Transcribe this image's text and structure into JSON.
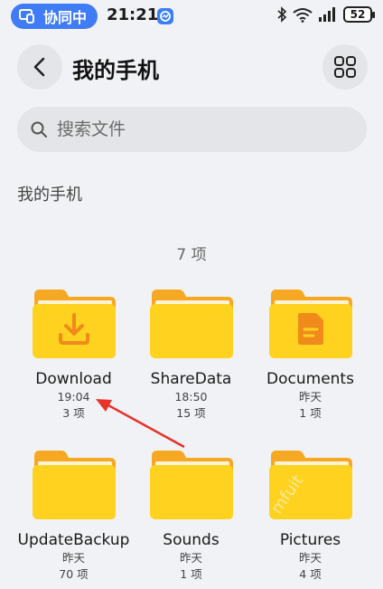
{
  "status_bar": {
    "collab_label": "协同中",
    "time": "21:21",
    "battery": "52"
  },
  "header": {
    "title": "我的手机"
  },
  "search": {
    "placeholder": "搜索文件"
  },
  "breadcrumb": "我的手机",
  "item_count": "7 项",
  "folders": [
    {
      "name": "Download",
      "date": "19:04",
      "count": "3 项",
      "icon": "download-icon"
    },
    {
      "name": "ShareData",
      "date": "18:50",
      "count": "15 项",
      "icon": ""
    },
    {
      "name": "Documents",
      "date": "昨天",
      "count": "1 项",
      "icon": "document-icon"
    },
    {
      "name": "UpdateBackup",
      "date": "昨天",
      "count": "70 项",
      "icon": ""
    },
    {
      "name": "Sounds",
      "date": "昨天",
      "count": "1 项",
      "icon": ""
    },
    {
      "name": "Pictures",
      "date": "昨天",
      "count": "4 项",
      "icon": ""
    }
  ],
  "colors": {
    "accent": "#3f7cf5",
    "folder_back": "#f7a823",
    "folder_front": "#ffd21f",
    "folder_icon": "#f08a1a",
    "annotation_arrow": "#e8322a"
  }
}
